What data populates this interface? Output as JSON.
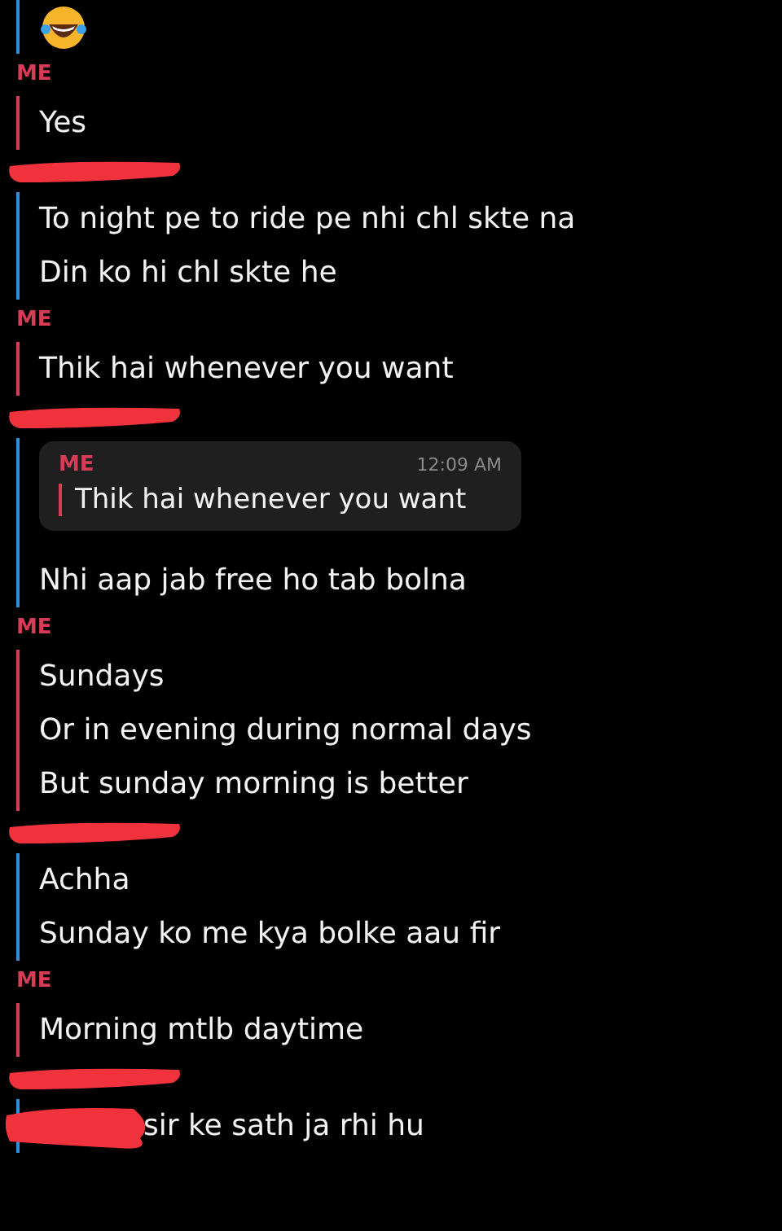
{
  "items": [
    {
      "kind": "group",
      "color": "#2f8fd8",
      "redacted": false,
      "messages": [
        {
          "kind": "emoji"
        }
      ]
    },
    {
      "kind": "group",
      "color": "#d63c55",
      "label": "ME",
      "messages": [
        {
          "kind": "text",
          "text": "Yes"
        }
      ]
    },
    {
      "kind": "group",
      "color": "#2f8fd8",
      "redacted": true,
      "messages": [
        {
          "kind": "text",
          "text": "To night pe to ride pe nhi chl skte na"
        },
        {
          "kind": "text",
          "text": "Din ko hi chl skte he"
        }
      ]
    },
    {
      "kind": "group",
      "color": "#d63c55",
      "label": "ME",
      "messages": [
        {
          "kind": "text",
          "text": "Thik hai whenever you want"
        }
      ]
    },
    {
      "kind": "group",
      "color": "#2f8fd8",
      "redacted": true,
      "messages": [
        {
          "kind": "quote",
          "label": "ME",
          "time": "12:09 AM",
          "text": "Thik hai whenever you want"
        },
        {
          "kind": "text",
          "text": "Nhi aap jab free ho tab bolna"
        }
      ]
    },
    {
      "kind": "group",
      "color": "#d63c55",
      "label": "ME",
      "messages": [
        {
          "kind": "text",
          "text": "Sundays"
        },
        {
          "kind": "text",
          "text": "Or in evening during normal days"
        },
        {
          "kind": "text",
          "text": "But sunday morning is better"
        }
      ]
    },
    {
      "kind": "group",
      "color": "#2f8fd8",
      "redacted": true,
      "messages": [
        {
          "kind": "text",
          "text": "Achha"
        },
        {
          "kind": "text",
          "text": "Sunday ko me kya bolke aau fir"
        }
      ]
    },
    {
      "kind": "group",
      "color": "#d63c55",
      "label": "ME",
      "messages": [
        {
          "kind": "text",
          "text": "Morning mtlb daytime"
        }
      ]
    },
    {
      "kind": "group",
      "color": "#2f8fd8",
      "redacted": true,
      "messages": [
        {
          "kind": "text",
          "text": "sir ke sath ja rhi hu",
          "redacted_start": true
        }
      ]
    }
  ]
}
